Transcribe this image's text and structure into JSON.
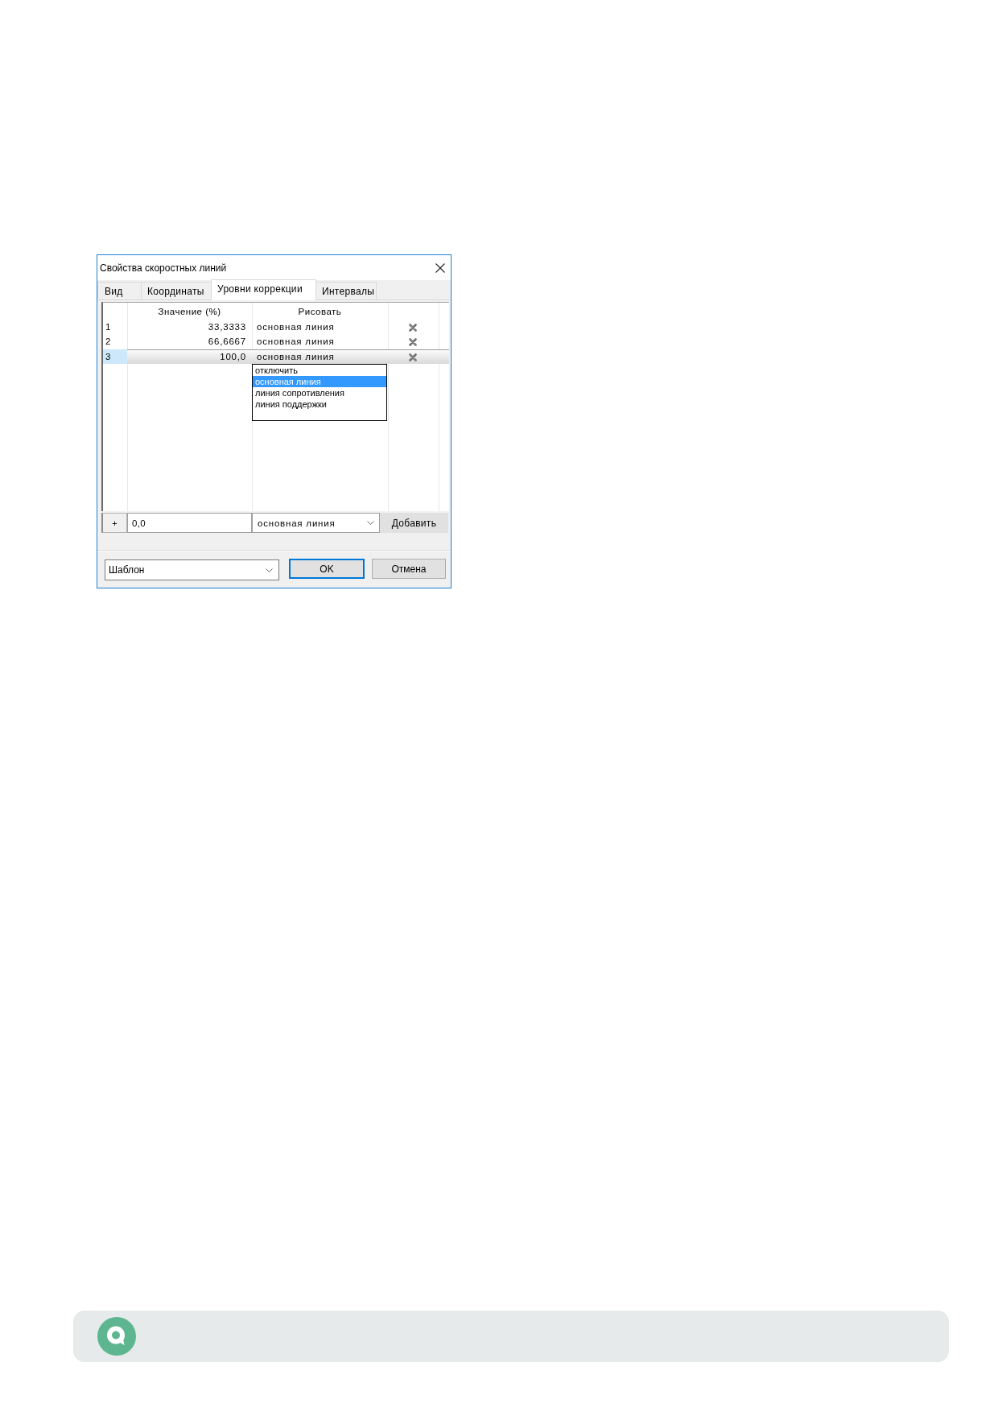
{
  "window": {
    "title": "Свойства скоростных линий"
  },
  "tabs": [
    {
      "label": "Вид",
      "selected": false
    },
    {
      "label": "Координаты",
      "selected": false
    },
    {
      "label": "Уровни коррекции",
      "selected": true
    },
    {
      "label": "Интервалы",
      "selected": false
    }
  ],
  "table": {
    "columns": [
      {
        "label": "Значение (%)"
      },
      {
        "label": "Рисовать"
      }
    ],
    "rows": [
      {
        "number": "1",
        "value": "33,3333",
        "draw": "основная линия",
        "selected": false
      },
      {
        "number": "2",
        "value": "66,6667",
        "draw": "основная линия",
        "selected": false
      },
      {
        "number": "3",
        "value": "100,0",
        "draw": "основная линия",
        "selected": true
      }
    ]
  },
  "dropdown_list": {
    "items": [
      {
        "label": "отключить",
        "selected": false
      },
      {
        "label": "основная линия",
        "selected": true
      },
      {
        "label": "линия сопротивления",
        "selected": false
      },
      {
        "label": "линия поддержки",
        "selected": false
      }
    ]
  },
  "add_row": {
    "marker": "+",
    "value": "0,0",
    "draw": "основная линия",
    "button": "Добавить"
  },
  "template_select": {
    "value": "Шаблон"
  },
  "buttons": [
    {
      "label": "OK",
      "default": true
    },
    {
      "label": "Отмена",
      "default": false
    }
  ]
}
